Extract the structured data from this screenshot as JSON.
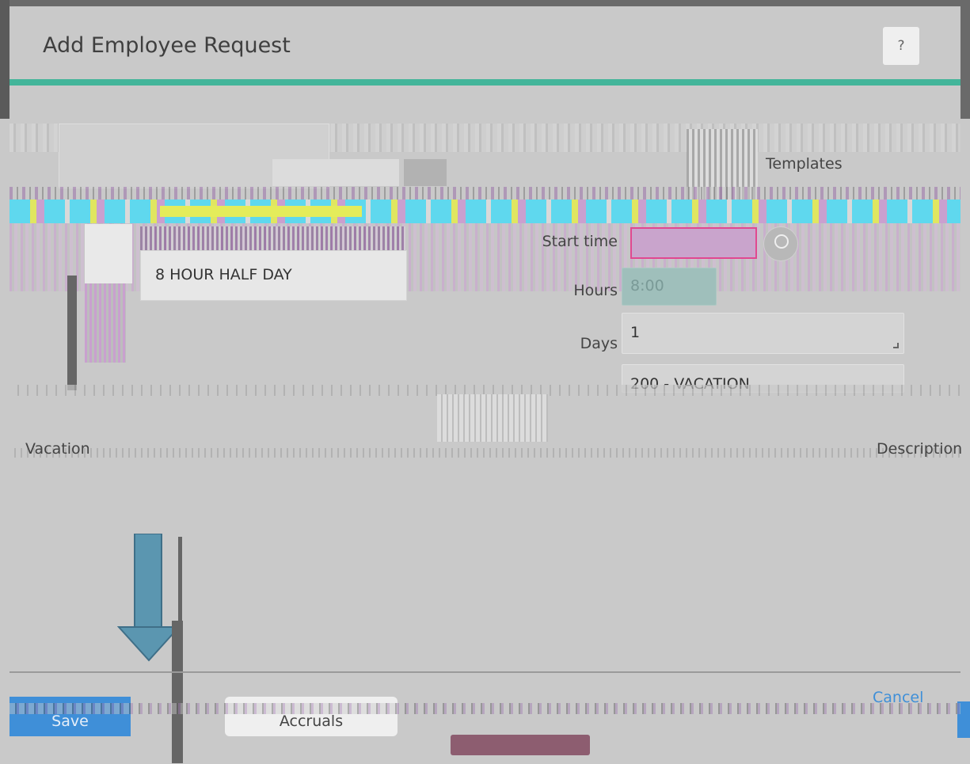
{
  "dialog": {
    "title": "Add Employee Request",
    "help_label": "?"
  },
  "templates": {
    "label": "Templates",
    "selected_item": "8 HOUR HALF DAY"
  },
  "form": {
    "start_time_label": "Start time",
    "start_time_value": "",
    "hours_label": "Hours",
    "hours_value": "8:00",
    "days_label": "Days",
    "days_value": "1",
    "code_value": "200 - VACATION"
  },
  "details": {
    "vacation_label": "Vacation",
    "description_label": "Description"
  },
  "footer": {
    "save_label": "Save",
    "accruals_label": "Accruals",
    "cancel_label": "Cancel"
  },
  "colors": {
    "accent_teal": "#43b59a",
    "primary_blue": "#3f8fd8",
    "arrow_blue": "#5b96b0",
    "background": "#c9c9c9"
  },
  "icons": {
    "help": "question-mark",
    "clock": "clock-icon",
    "arrow": "down-arrow-icon"
  }
}
